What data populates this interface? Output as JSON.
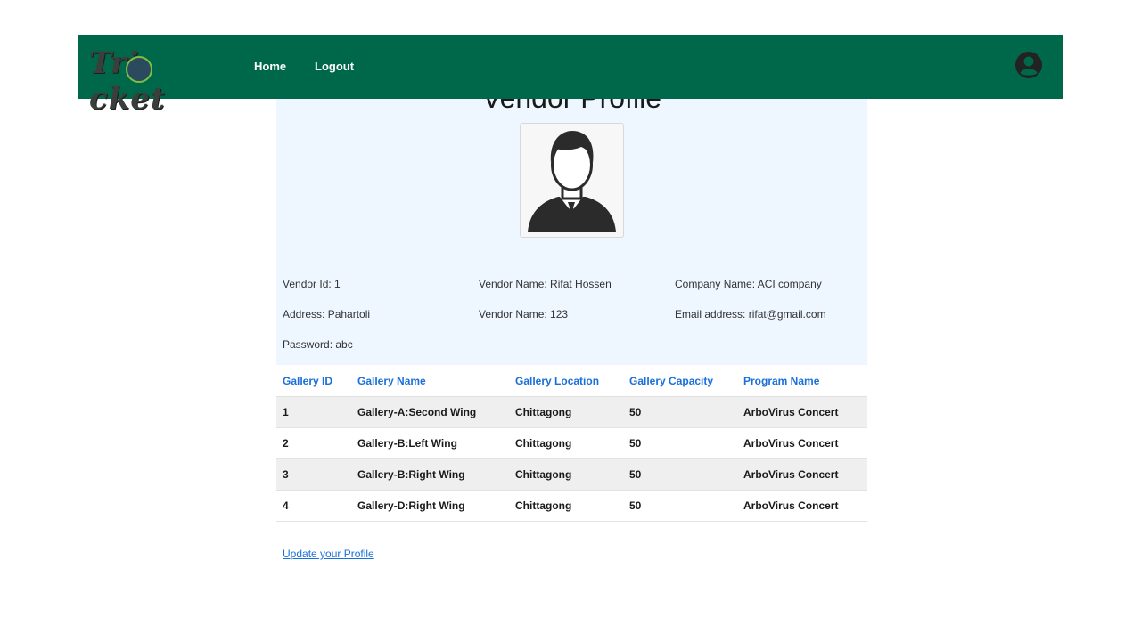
{
  "nav": {
    "logo_text": "Tri cket",
    "links": [
      "Home",
      "Logout"
    ]
  },
  "profile": {
    "title": "Vendor Profile",
    "fields": {
      "vendor_id": "Vendor Id: 1",
      "vendor_name": "Vendor Name: Rifat Hossen",
      "company_name": "Company Name: ACI company",
      "address": "Address: Pahartoli",
      "vendor_name_2": "Vendor Name: 123",
      "email": "Email address: rifat@gmail.com",
      "password": "Password: abc"
    }
  },
  "table": {
    "headers": [
      "Gallery ID",
      "Gallery Name",
      "Gallery Location",
      "Gallery Capacity",
      "Program Name"
    ],
    "rows": [
      [
        "1",
        "Gallery-A:Second Wing",
        "Chittagong",
        "50",
        "ArboVirus Concert"
      ],
      [
        "2",
        "Gallery-B:Left Wing",
        "Chittagong",
        "50",
        "ArboVirus Concert"
      ],
      [
        "3",
        "Gallery-B:Right Wing",
        "Chittagong",
        "50",
        "ArboVirus Concert"
      ],
      [
        "4",
        "Gallery-D:Right Wing",
        "Chittagong",
        "50",
        "ArboVirus Concert"
      ]
    ]
  },
  "update_link": "Update your Profile",
  "colors": {
    "navbar": "#00684a",
    "link": "#1a6fd9",
    "panel": "#eef6ff"
  },
  "icons": {
    "user": "account-circle-icon",
    "avatar": "businessman-avatar"
  }
}
